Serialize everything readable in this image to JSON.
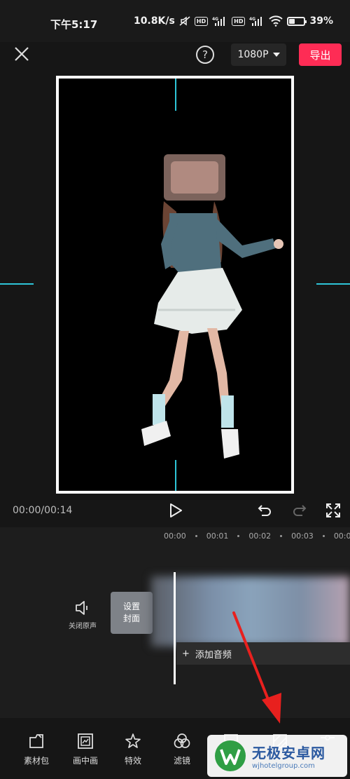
{
  "status_bar": {
    "time": "下午5:17",
    "speed": "10.8K/s",
    "battery": "39%",
    "battery_level": 0.39,
    "icons": [
      "mute-icon",
      "hd-icon",
      "signal-4g-icon",
      "hd-icon",
      "signal-4g-icon",
      "wifi-icon",
      "battery-icon"
    ]
  },
  "toolbar": {
    "close_icon": "close-icon",
    "help_icon": "help-icon",
    "help_glyph": "?",
    "resolution": "1080P",
    "export_label": "导出"
  },
  "playback": {
    "time": "00:00/00:14",
    "icons": [
      "play-icon",
      "undo-icon",
      "redo-icon",
      "fullscreen-icon"
    ]
  },
  "timeline": {
    "ruler": [
      "00:00",
      "00:01",
      "00:02",
      "00:03",
      "00:0"
    ],
    "mute_label": "关闭原声",
    "cover_label_1": "设置",
    "cover_label_2": "封面",
    "add_audio_label": "添加音频",
    "add_audio_glyph": "+"
  },
  "bottom_toolbar": {
    "items": [
      {
        "label": "素材包",
        "icon": "material-pack-icon"
      },
      {
        "label": "画中画",
        "icon": "picture-in-picture-icon"
      },
      {
        "label": "特效",
        "icon": "effects-icon"
      },
      {
        "label": "滤镜",
        "icon": "filter-icon"
      },
      {
        "label": "",
        "icon": "ratio-icon"
      },
      {
        "label": "",
        "icon": "background-icon"
      },
      {
        "label": "",
        "icon": "adjust-icon"
      }
    ]
  },
  "watermark": {
    "name": "无极安卓网",
    "url": "wjhotelgroup.com"
  },
  "colors": {
    "accent": "#fe2c55",
    "guide": "#2ec5d8",
    "background": "#161616",
    "annotation_arrow": "#e8201e"
  }
}
